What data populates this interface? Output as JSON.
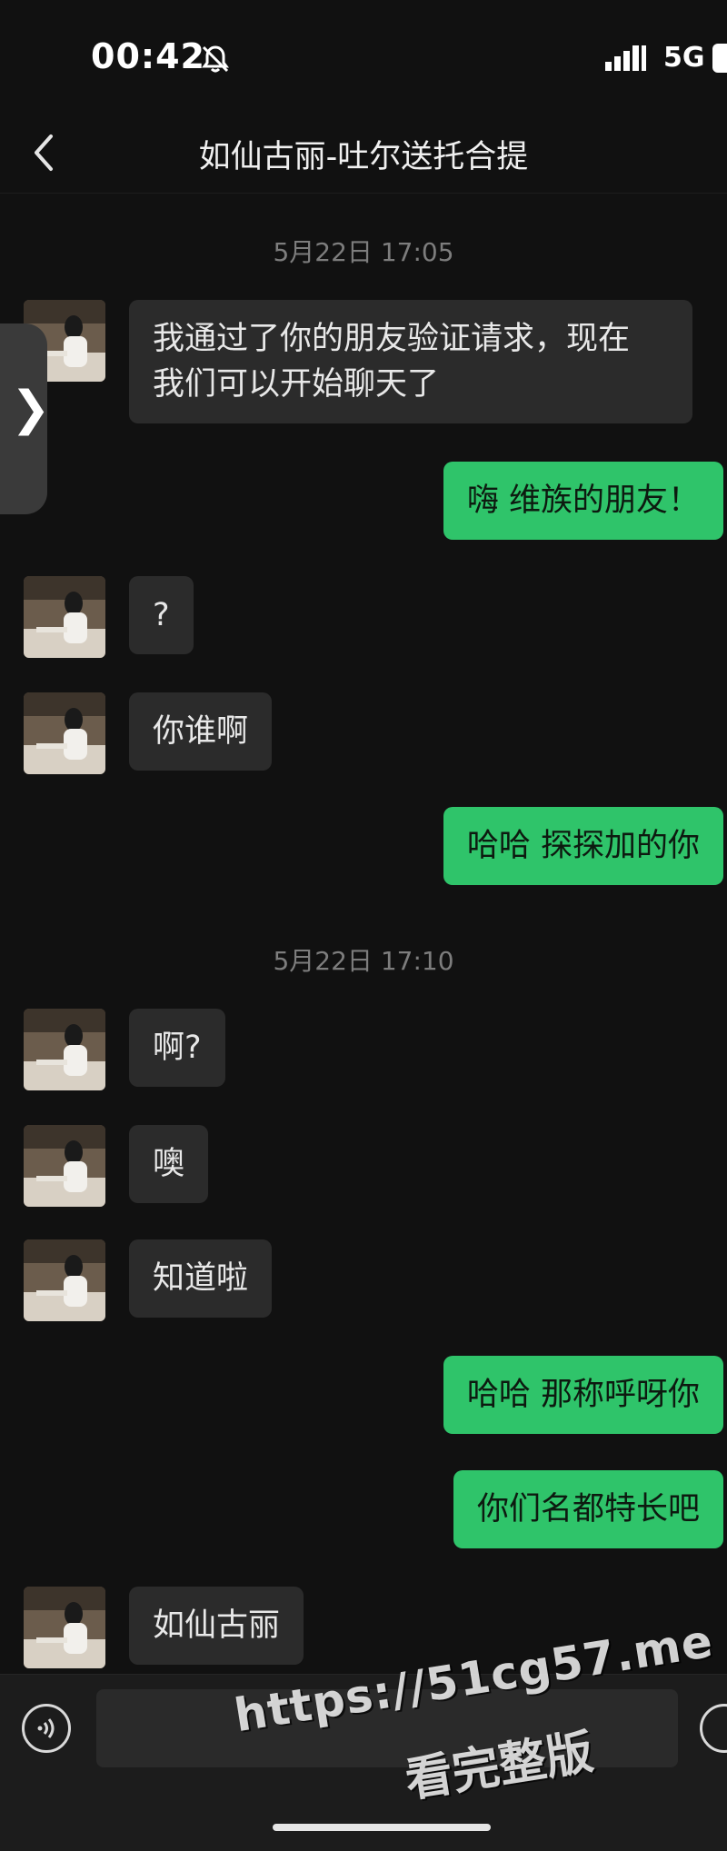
{
  "status": {
    "time": "00:42",
    "network": "5G"
  },
  "header": {
    "title": "如仙古丽-吐尔送托合提"
  },
  "messages": [
    {
      "kind": "timestamp",
      "text": "5月22日 17:05"
    },
    {
      "kind": "in",
      "text": "我通过了你的朋友验证请求，现在\n我们可以开始聊天了"
    },
    {
      "kind": "out",
      "text": "嗨 维族的朋友！"
    },
    {
      "kind": "in",
      "text": "?"
    },
    {
      "kind": "in",
      "text": "你谁啊"
    },
    {
      "kind": "out",
      "text": "哈哈 探探加的你"
    },
    {
      "kind": "timestamp",
      "text": "5月22日 17:10"
    },
    {
      "kind": "in",
      "text": "啊?"
    },
    {
      "kind": "in",
      "text": "噢"
    },
    {
      "kind": "in",
      "text": "知道啦"
    },
    {
      "kind": "out",
      "text": "哈哈 那称呼呀你"
    },
    {
      "kind": "out",
      "text": "你们名都特长吧"
    },
    {
      "kind": "in",
      "text": "如仙古丽"
    }
  ],
  "watermark": {
    "line1": "https://51cg57.me",
    "line2": "看完整版"
  },
  "icons": {
    "back": "chevron-left-icon",
    "mute": "bell-slash-icon",
    "signal": "signal-bars-icon",
    "battery": "battery-icon",
    "voice": "voice-icon",
    "emoji": "emoji-icon",
    "side": "chevron-right-icon"
  },
  "colors": {
    "background": "#111111",
    "incoming": "#2b2b2b",
    "outgoing": "#2fc46a"
  }
}
